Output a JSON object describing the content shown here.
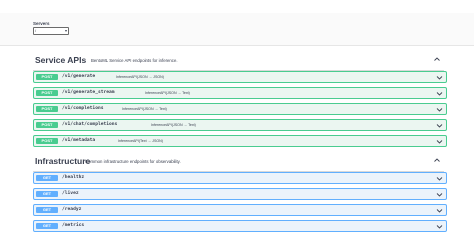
{
  "servers": {
    "label": "Servers",
    "selected": "/"
  },
  "sections": {
    "service": {
      "title": "Service APIs",
      "description": "BentoML Service API endpoints for inference.",
      "operations": [
        {
          "method": "POST",
          "path": "/v1/generate",
          "summary": "InferenceAPI(JSON → JSON)"
        },
        {
          "method": "POST",
          "path": "/v1/generate_stream",
          "summary": "InferenceAPI(JSON → Text)"
        },
        {
          "method": "POST",
          "path": "/v1/completions",
          "summary": "InferenceAPI(JSON → Text)"
        },
        {
          "method": "POST",
          "path": "/v1/chat/completions",
          "summary": "InferenceAPI(JSON → Text)"
        },
        {
          "method": "POST",
          "path": "/v1/metadata",
          "summary": "InferenceAPI(Text → JSON)"
        }
      ]
    },
    "infra": {
      "title": "Infrastructure",
      "description": "Common infrastructure endpoints for observability.",
      "operations": [
        {
          "method": "GET",
          "path": "/healthz",
          "summary": ""
        },
        {
          "method": "GET",
          "path": "/livez",
          "summary": ""
        },
        {
          "method": "GET",
          "path": "/readyz",
          "summary": ""
        },
        {
          "method": "GET",
          "path": "/metrics",
          "summary": ""
        }
      ]
    }
  },
  "colors": {
    "post": "#49cc90",
    "get": "#61affe",
    "text": "#3b4151"
  },
  "icons": {
    "collapse": "chevron-up-icon",
    "expand": "chevron-down-icon",
    "select": "caret-down-icon"
  }
}
